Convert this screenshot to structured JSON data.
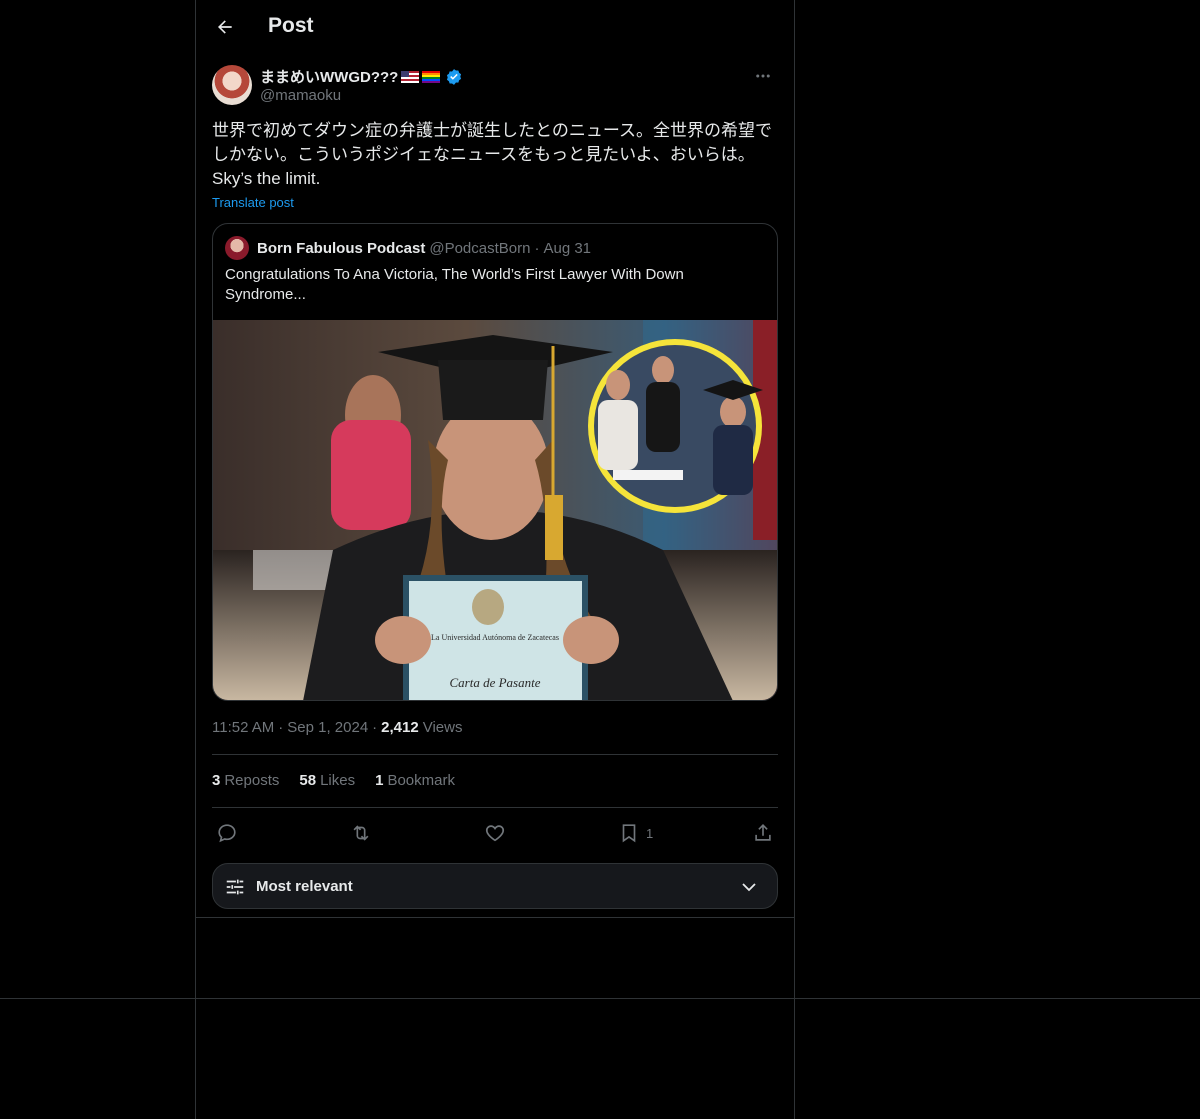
{
  "header": {
    "title": "Post"
  },
  "post": {
    "author_name": "ままめいWWGD???",
    "author_handle": "@mamaoku",
    "text": "世界で初めてダウン症の弁護士が誕生したとのニュース。全世界の希望でしかない。こういうポジイェなニュースをもっと見たいよ、おいらは。\nSky’s the limit.",
    "translate_label": "Translate post",
    "time": "11:52 AM",
    "date": "Sep 1, 2024",
    "views_count": "2,412",
    "views_label": "Views"
  },
  "quote": {
    "name": "Born Fabulous Podcast",
    "handle": "@PodcastBorn",
    "dot": "·",
    "date": "Aug 31",
    "text": "Congratulations To Ana Victoria, The World’s First Lawyer With Down Syndrome...",
    "image_certificate_line1": "La Universidad Autónoma de Zacatecas",
    "image_certificate_line2": "Carta de Pasante"
  },
  "stats": {
    "reposts_count": "3",
    "reposts_label": "Reposts",
    "likes_count": "58",
    "likes_label": "Likes",
    "bookmarks_count": "1",
    "bookmarks_label": "Bookmark"
  },
  "actions": {
    "bookmark_count": "1"
  },
  "sort": {
    "label": "Most relevant"
  },
  "icons": {
    "back": "arrow-left-icon",
    "more": "more-horizontal-icon",
    "verified": "verified-badge-icon",
    "reply": "reply-icon",
    "repost": "repost-icon",
    "like": "heart-icon",
    "bookmark": "bookmark-icon",
    "share": "share-icon",
    "sort": "sliders-icon",
    "chevron": "chevron-down-icon"
  },
  "colors": {
    "background": "#000000",
    "accent": "#1d9bf0",
    "border": "#2f3336",
    "muted": "#71767b",
    "text": "#e7e9ea"
  }
}
